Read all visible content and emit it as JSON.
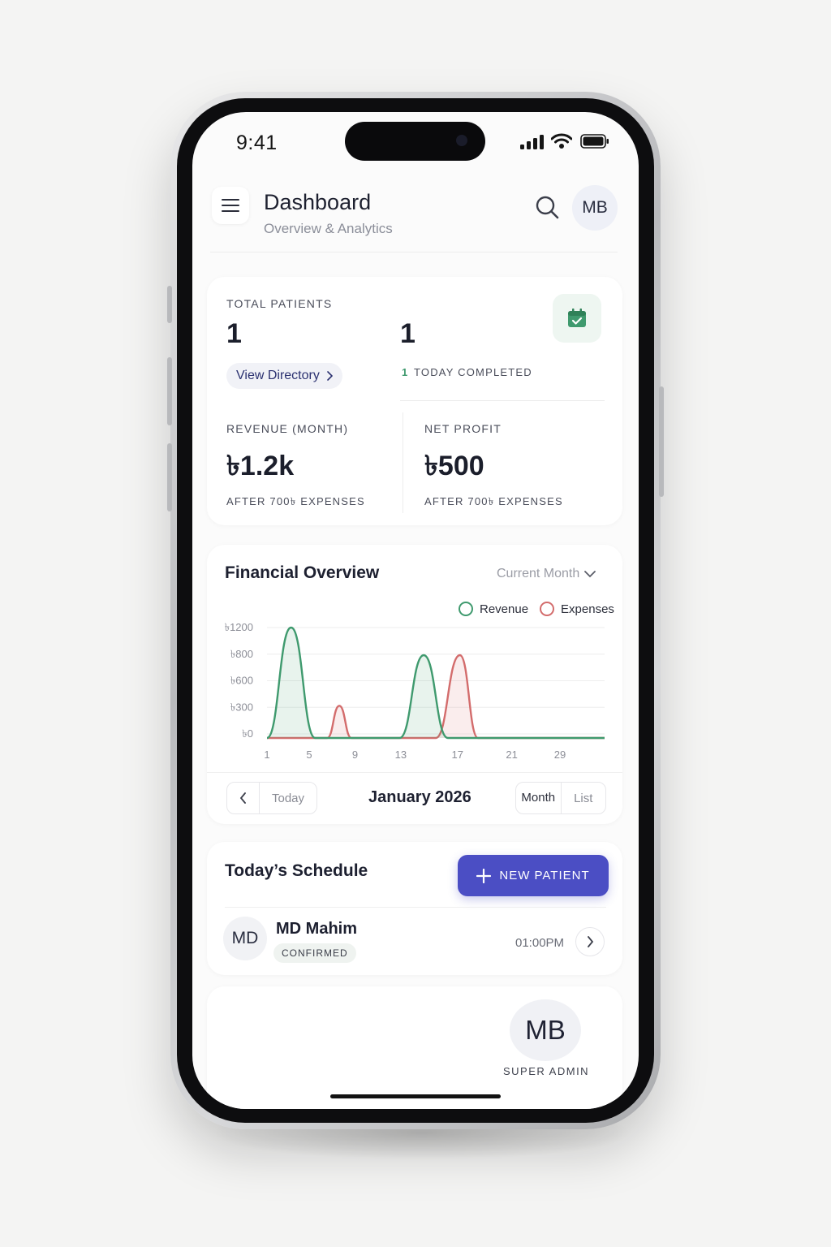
{
  "status_bar": {
    "time": "9:41"
  },
  "header": {
    "title": "Dashboard",
    "subtitle": "Overview & Analytics",
    "avatar_initials": "MB"
  },
  "stats": {
    "total_patients_label": "TOTAL PATIENTS",
    "total_patients_value": "1",
    "today_value": "1",
    "today_completed_count": "1",
    "today_completed_label": "TODAY COMPLETED",
    "view_directory_label": "View Directory",
    "revenue_label": "REVENUE (MONTH)",
    "revenue_value": "৳1.2k",
    "revenue_note": "AFTER 700৳ EXPENSES",
    "net_profit_label": "NET PROFIT",
    "net_profit_value": "৳500",
    "net_profit_note": "AFTER 700৳ EXPENSES"
  },
  "financial": {
    "title": "Financial Overview",
    "period_select": "Current Month",
    "legend_revenue": "Revenue",
    "legend_expenses": "Expenses",
    "month_label": "January 2026",
    "today_button": "Today",
    "view_month": "Month",
    "view_list": "List"
  },
  "chart_data": {
    "type": "area",
    "y_tick_labels": [
      "৳1200",
      "৳800",
      "৳600",
      "৳300",
      "৳0"
    ],
    "x_tick_labels": [
      "1",
      "5",
      "9",
      "13",
      "17",
      "21",
      "29"
    ],
    "series": [
      {
        "name": "Revenue",
        "color": "#3f9a6e",
        "points": [
          [
            1,
            0
          ],
          [
            3,
            1200
          ],
          [
            5,
            0
          ],
          [
            12,
            0
          ],
          [
            14,
            900
          ],
          [
            16,
            0
          ],
          [
            29,
            0
          ]
        ]
      },
      {
        "name": "Expenses",
        "color": "#d36c6c",
        "points": [
          [
            1,
            0
          ],
          [
            6,
            0
          ],
          [
            7,
            350
          ],
          [
            8,
            0
          ],
          [
            15,
            0
          ],
          [
            17,
            900
          ],
          [
            18.5,
            0
          ],
          [
            29,
            0
          ]
        ]
      }
    ],
    "xlim": [
      1,
      29
    ],
    "ylim": [
      0,
      1200
    ],
    "grid": true,
    "legend": "top-right"
  },
  "schedule": {
    "title": "Today’s Schedule",
    "new_patient_label": "NEW PATIENT",
    "appointments": [
      {
        "initials": "MD",
        "name": "MD Mahim",
        "status": "CONFIRMED",
        "time": "01:00PM"
      }
    ]
  },
  "admin": {
    "initials": "MB",
    "role": "SUPER ADMIN"
  },
  "colors": {
    "accent": "#4b4ec4",
    "revenue": "#3f9a6e",
    "expenses": "#d36c6c",
    "calendar": "#3f9a6e"
  }
}
